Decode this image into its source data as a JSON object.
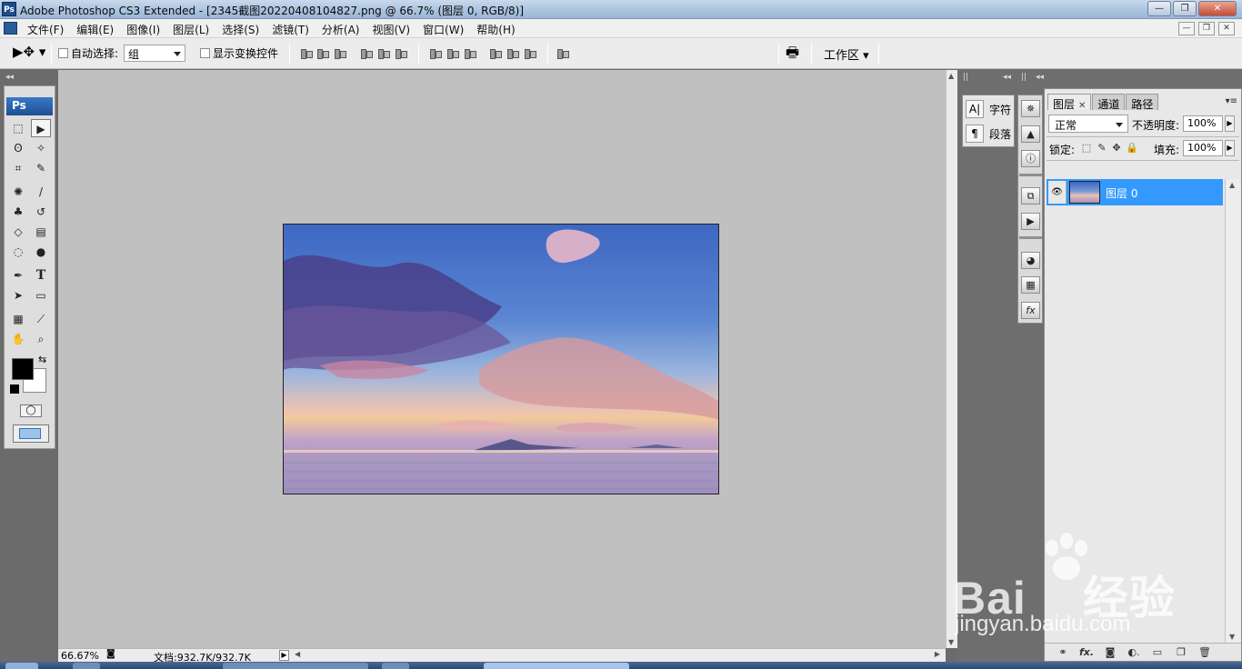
{
  "window": {
    "title": "Adobe Photoshop CS3 Extended - [2345截图20220408104827.png @ 66.7% (图层 0, RGB/8)]",
    "app_icon": "Ps",
    "controls": [
      "minimize-icon",
      "restore-icon",
      "close-icon"
    ]
  },
  "menubar": {
    "items": [
      "文件(F)",
      "编辑(E)",
      "图像(I)",
      "图层(L)",
      "选择(S)",
      "滤镜(T)",
      "分析(A)",
      "视图(V)",
      "窗口(W)",
      "帮助(H)"
    ]
  },
  "options": {
    "auto_select_label": "自动选择:",
    "auto_select_value": "组",
    "show_transform_label": "显示变换控件",
    "workspace_label": "工作区"
  },
  "toolbox": {
    "header": "Ps",
    "text_tool_glyph": "T",
    "foreground_color": "#000000",
    "background_color": "#ffffff"
  },
  "status": {
    "zoom": "66.67%",
    "doc_info": "文档:932.7K/932.7K"
  },
  "char_panel": {
    "character_label": "字符",
    "paragraph_label": "段落",
    "character_glyph": "A|",
    "paragraph_glyph": "¶"
  },
  "layers_panel": {
    "tabs": [
      "图层",
      "通道",
      "路径"
    ],
    "blend_mode": "正常",
    "opacity_label": "不透明度:",
    "opacity_value": "100%",
    "lock_label": "锁定:",
    "fill_label": "填充:",
    "fill_value": "100%",
    "layers": [
      {
        "name": "图层 0",
        "visible": true,
        "selected": true
      }
    ]
  },
  "watermark": {
    "brand": "Bai",
    "brand2": "经验",
    "url": "jingyan.baidu.com"
  },
  "colors": {
    "selected_layer": "#3399ff",
    "workarea": "#c0c0c0",
    "panel_dark": "#6e6e6e"
  }
}
